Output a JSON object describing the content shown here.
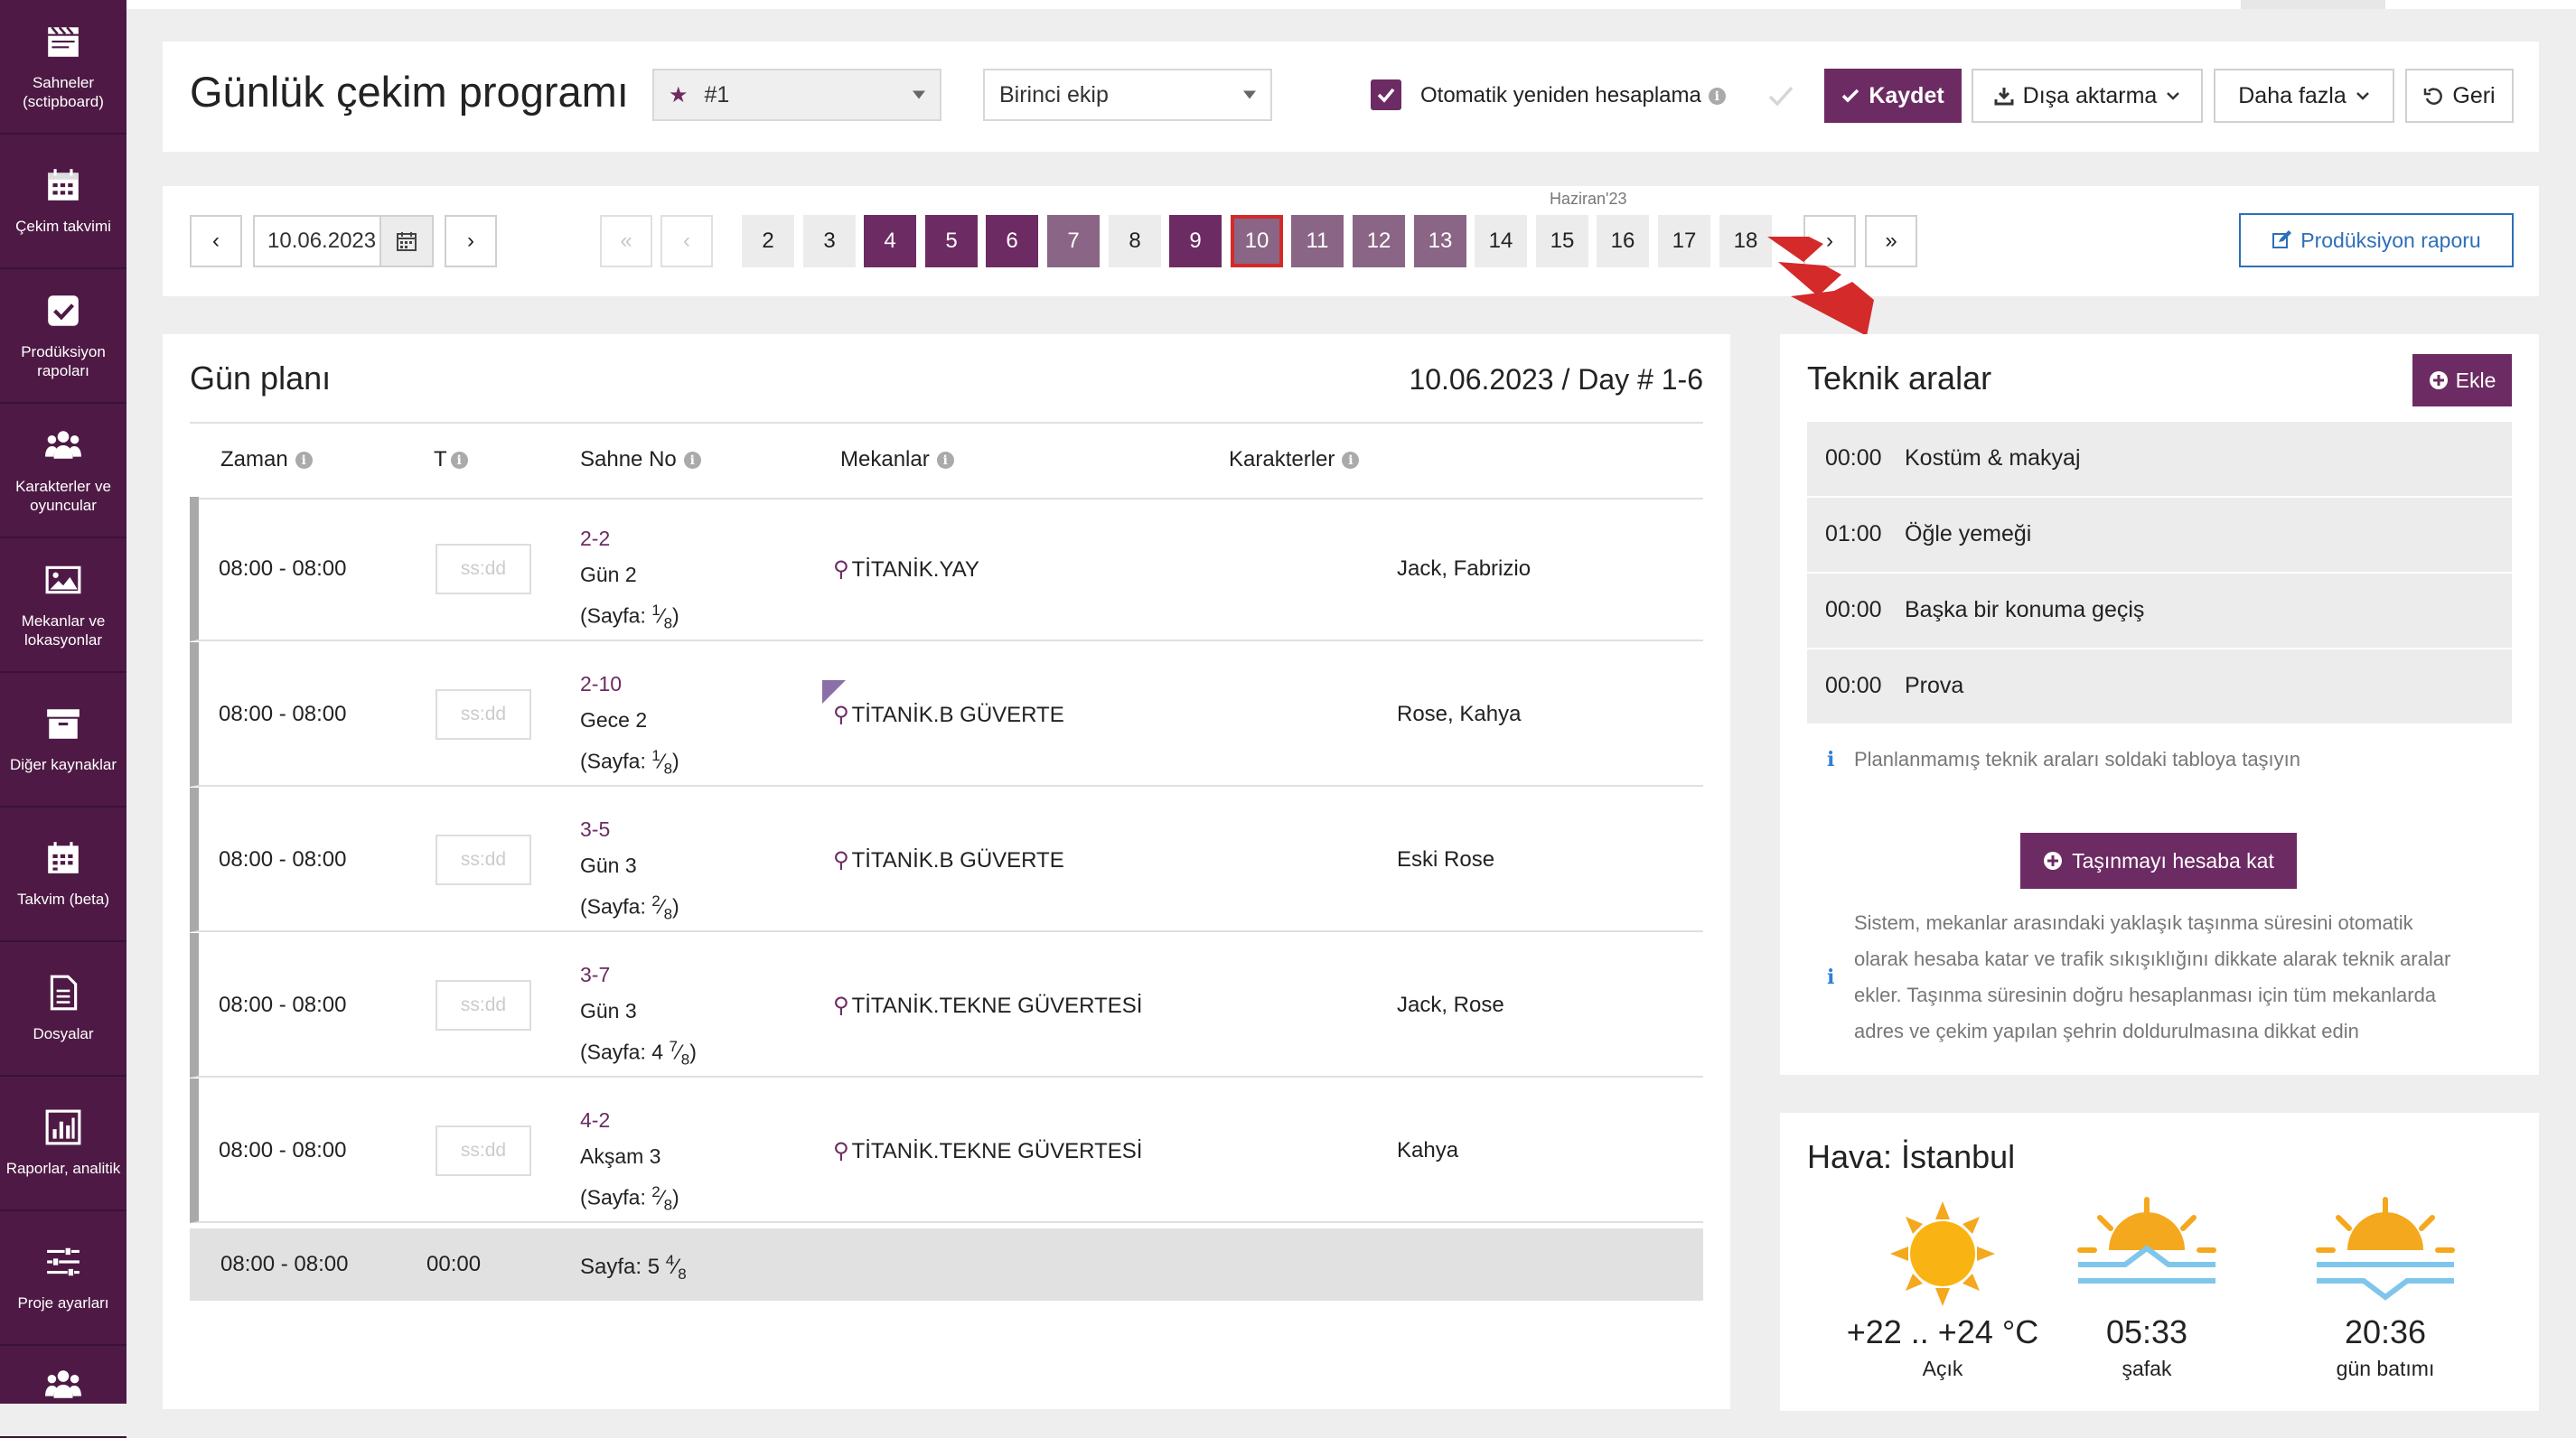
{
  "sidebar": {
    "items": [
      {
        "label": "Sahneler (sctipboard)",
        "icon": "clapperboard-icon"
      },
      {
        "label": "Çekim takvimi",
        "icon": "calendar-icon"
      },
      {
        "label": "Prodüksiyon rapoları",
        "icon": "checkbox-icon"
      },
      {
        "label": "Karakterler ve oyuncular",
        "icon": "people-icon"
      },
      {
        "label": "Mekanlar ve lokasyonlar",
        "icon": "image-icon"
      },
      {
        "label": "Diğer kaynaklar",
        "icon": "archive-icon"
      },
      {
        "label": "Takvim (beta)",
        "icon": "calendar-icon"
      },
      {
        "label": "Dosyalar",
        "icon": "file-icon"
      },
      {
        "label": "Raporlar, analitik",
        "icon": "chart-icon"
      },
      {
        "label": "Proje ayarları",
        "icon": "sliders-icon"
      },
      {
        "label": "",
        "icon": "people-icon"
      }
    ]
  },
  "header": {
    "title": "Günlük çekim programı",
    "schedule_select": "#1",
    "crew_select": "Birinci ekip",
    "auto_recalc_label": "Otomatik yeniden hesaplama",
    "save_label": "Kaydet",
    "export_label": "Dışa aktarma",
    "more_label": "Daha fazla",
    "back_label": "Geri"
  },
  "date_nav": {
    "date_value": "10.06.2023",
    "prev_label": "‹",
    "next_label": "›",
    "first_label": "«",
    "last_label": "»",
    "month_label": "Haziran'23",
    "days": [
      {
        "n": "2",
        "state": "plain"
      },
      {
        "n": "3",
        "state": "plain"
      },
      {
        "n": "4",
        "state": "dark"
      },
      {
        "n": "5",
        "state": "dark"
      },
      {
        "n": "6",
        "state": "dark"
      },
      {
        "n": "7",
        "state": "mid"
      },
      {
        "n": "8",
        "state": "plain"
      },
      {
        "n": "9",
        "state": "dark"
      },
      {
        "n": "10",
        "state": "selected"
      },
      {
        "n": "11",
        "state": "mid"
      },
      {
        "n": "12",
        "state": "mid"
      },
      {
        "n": "13",
        "state": "mid"
      },
      {
        "n": "14",
        "state": "plain"
      },
      {
        "n": "15",
        "state": "plain"
      },
      {
        "n": "16",
        "state": "plain"
      },
      {
        "n": "17",
        "state": "plain"
      },
      {
        "n": "18",
        "state": "plain"
      }
    ],
    "production_report_label": "Prodüksiyon raporu"
  },
  "day_plan": {
    "title": "Gün planı",
    "day_info": "10.06.2023 / Day # 1-6",
    "columns": {
      "time": "Zaman",
      "t": "T",
      "scene": "Sahne No",
      "locations": "Mekanlar",
      "characters": "Karakterler"
    },
    "rows": [
      {
        "time": "08:00 - 08:00",
        "t_placeholder": "ss:dd",
        "scene_no": "2-2",
        "scene_day": "Gün 2",
        "page_prefix": "(Sayfa: ",
        "page_whole": "",
        "page_num": "1",
        "page_den": "8",
        "location": "TİTANİK.YAY",
        "characters": "Jack, Fabrizio"
      },
      {
        "time": "08:00 - 08:00",
        "t_placeholder": "ss:dd",
        "scene_no": "2-10",
        "scene_day": "Gece 2",
        "page_prefix": "(Sayfa: ",
        "page_whole": "",
        "page_num": "1",
        "page_den": "8",
        "location": "TİTANİK.B GÜVERTE",
        "characters": "Rose, Kahya"
      },
      {
        "time": "08:00 - 08:00",
        "t_placeholder": "ss:dd",
        "scene_no": "3-5",
        "scene_day": "Gün 3",
        "page_prefix": "(Sayfa: ",
        "page_whole": "",
        "page_num": "2",
        "page_den": "8",
        "location": "TİTANİK.B GÜVERTE",
        "characters": "Eski Rose"
      },
      {
        "time": "08:00 - 08:00",
        "t_placeholder": "ss:dd",
        "scene_no": "3-7",
        "scene_day": "Gün 3",
        "page_prefix": "(Sayfa: ",
        "page_whole": "4 ",
        "page_num": "7",
        "page_den": "8",
        "location": "TİTANİK.TEKNE GÜVERTESİ",
        "characters": "Jack, Rose"
      },
      {
        "time": "08:00 - 08:00",
        "t_placeholder": "ss:dd",
        "scene_no": "4-2",
        "scene_day": "Akşam 3",
        "page_prefix": "(Sayfa: ",
        "page_whole": "",
        "page_num": "2",
        "page_den": "8",
        "location": "TİTANİK.TEKNE GÜVERTESİ",
        "characters": "Kahya"
      }
    ],
    "summary": {
      "time": "08:00 - 08:00",
      "t": "00:00",
      "page_prefix": "Sayfa: 5 ",
      "page_num": "4",
      "page_den": "8"
    }
  },
  "tech_breaks": {
    "title": "Teknik aralar",
    "add_label": "Ekle",
    "items": [
      {
        "time": "00:00",
        "name": "Kostüm & makyaj"
      },
      {
        "time": "01:00",
        "name": "Öğle yemeği"
      },
      {
        "time": "00:00",
        "name": "Başka bir konuma geçiş"
      },
      {
        "time": "00:00",
        "name": "Prova"
      }
    ],
    "hint": "Planlanmamış teknik araları soldaki tabloya taşıyın",
    "move_button": "Taşınmayı hesaba kat",
    "note_lines": [
      "Sistem, mekanlar arasındaki yaklaşık taşınma süresini otomatik",
      "olarak hesaba katar ve trafik sıkışıklığını dikkate alarak teknik aralar",
      "ekler. Taşınma süresinin doğru hesaplanması için tüm mekanlarda",
      "adres ve çekim yapılan şehrin doldurulmasına dikkat edin"
    ]
  },
  "weather": {
    "title": "Hava: İstanbul",
    "temp": "+22 .. +24 °C",
    "condition": "Açık",
    "sunrise": "05:33",
    "sunrise_label": "şafak",
    "sunset": "20:36",
    "sunset_label": "gün batımı"
  },
  "colors": {
    "accent": "#6d2b63",
    "sidebar": "#4e1a45",
    "link": "#2e6fb8",
    "highlight": "#d42a2a"
  }
}
